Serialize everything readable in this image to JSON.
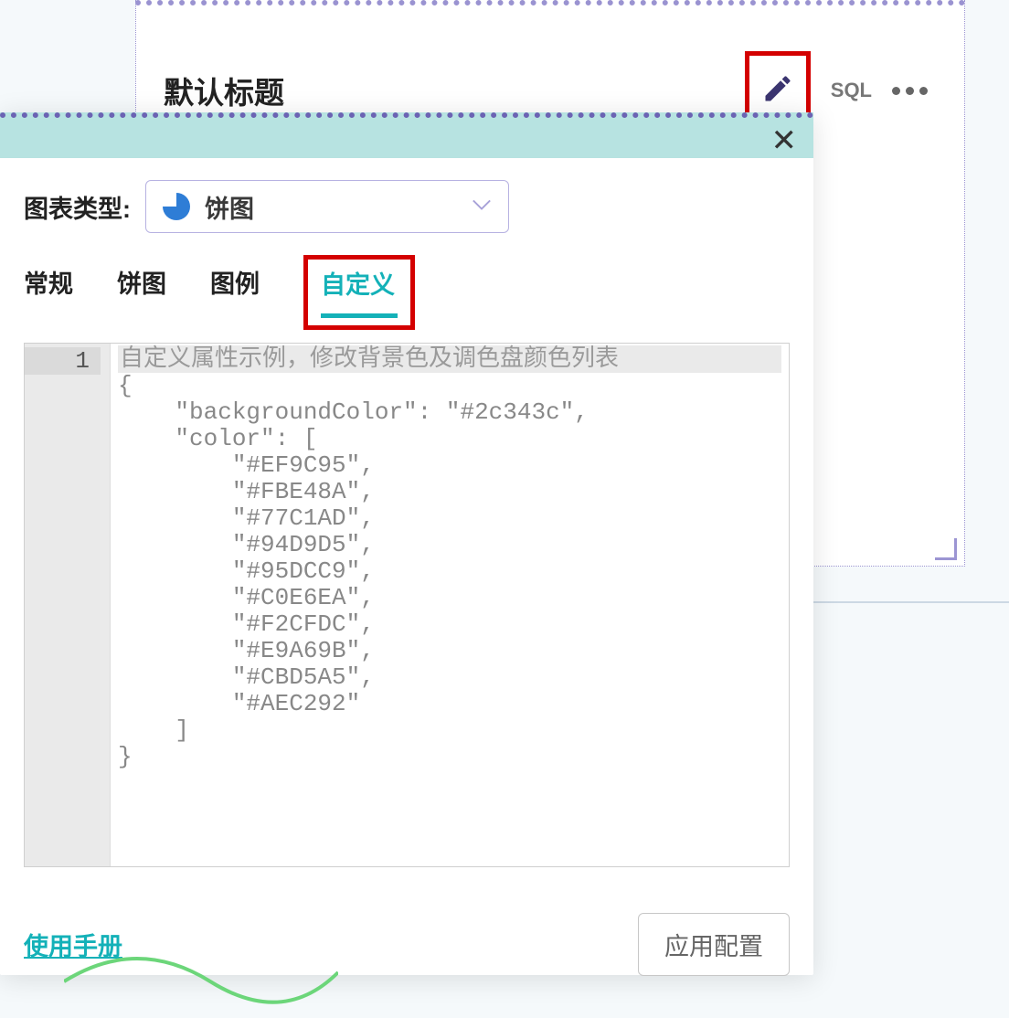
{
  "card": {
    "title": "默认标题",
    "sql_label": "SQL"
  },
  "panel": {
    "chart_type_label": "图表类型:",
    "chart_type_value": "饼图",
    "tabs": {
      "general": "常规",
      "pie": "饼图",
      "legend": "图例",
      "custom": "自定义"
    },
    "editor": {
      "line_number": "1",
      "placeholder_line": "自定义属性示例，修改背景色及调色盘颜色列表",
      "code": "{\n    \"backgroundColor\": \"#2c343c\",\n    \"color\": [\n        \"#EF9C95\",\n        \"#FBE48A\",\n        \"#77C1AD\",\n        \"#94D9D5\",\n        \"#95DCC9\",\n        \"#C0E6EA\",\n        \"#F2CFDC\",\n        \"#E9A69B\",\n        \"#CBD5A5\",\n        \"#AEC292\"\n    ]\n}"
    },
    "manual": "使用手册",
    "apply": "应用配置"
  }
}
